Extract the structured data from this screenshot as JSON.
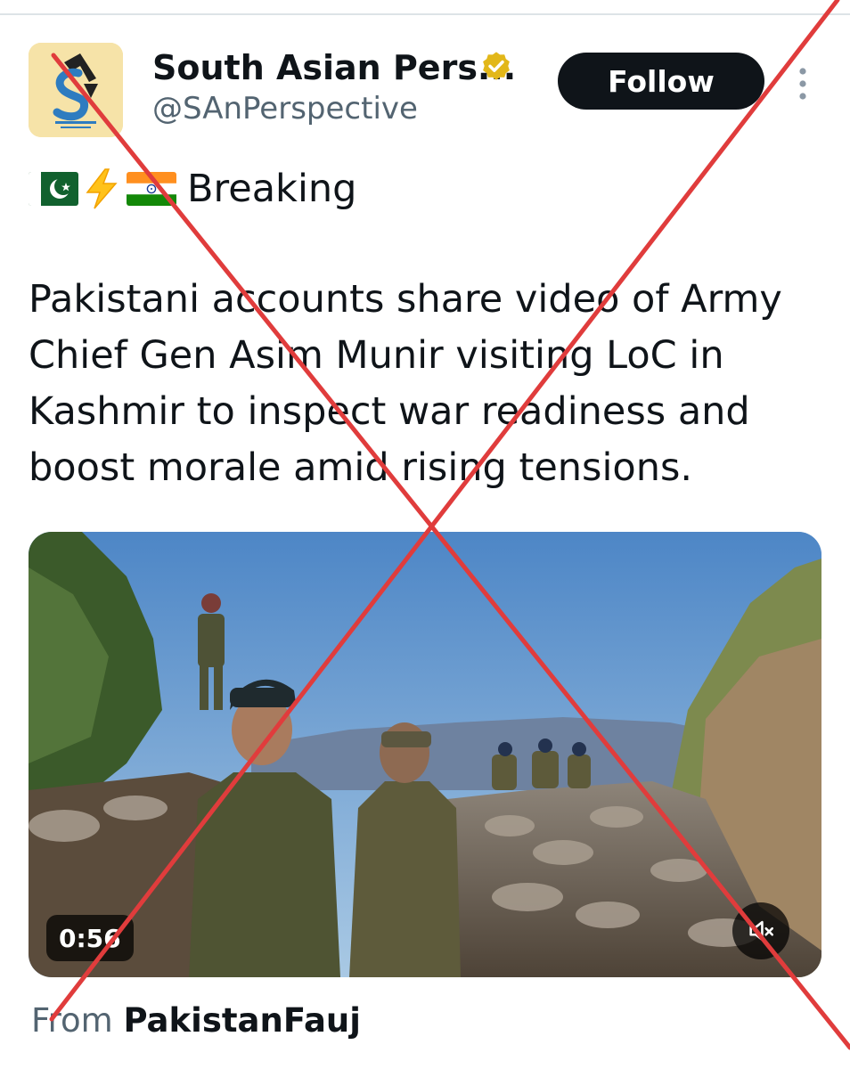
{
  "author": {
    "display_name": "South Asian Pers...",
    "handle": "@SAnPerspective",
    "verified": true,
    "avatar_icon": "south-asian-perspective-logo"
  },
  "follow_button": {
    "label": "Follow"
  },
  "tweet": {
    "emoji_prefix": [
      "pakistan-flag",
      "lightning-bolt",
      "india-flag"
    ],
    "headline": "Breaking",
    "body": "Pakistani accounts share video of Army Chief Gen Asim Munir visiting LoC in Kashmir to inspect war readiness and boost morale amid rising tensions."
  },
  "media": {
    "type": "video",
    "duration": "0:56",
    "muted": true
  },
  "source": {
    "prefix": "From",
    "name": "PakistanFauj"
  },
  "overlay": {
    "type": "red-cross",
    "color": "#e03c3c"
  },
  "colors": {
    "text_primary": "#0f1419",
    "text_secondary": "#536471",
    "follow_bg": "#0f1419",
    "verified_gold": "#e2b719"
  }
}
